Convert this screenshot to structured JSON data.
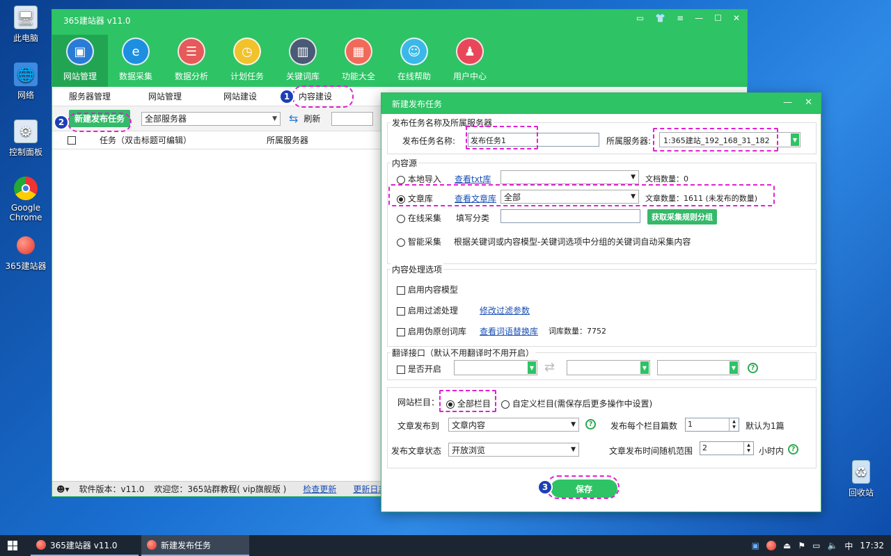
{
  "desktop": {
    "icons": [
      {
        "label": "此电脑",
        "icon": "computer-icon"
      },
      {
        "label": "网络",
        "icon": "network-icon"
      },
      {
        "label": "控制面板",
        "icon": "control-panel-icon"
      },
      {
        "label": "Google Chrome",
        "icon": "chrome-icon"
      },
      {
        "label": "365建站器",
        "icon": "apple-icon"
      },
      {
        "label": "回收站",
        "icon": "recycle-bin-icon"
      }
    ]
  },
  "app": {
    "title": "365建站器 v11.0",
    "toolbar": [
      {
        "label": "网站管理",
        "icon": "monitor-icon",
        "color": "#2a7bd6"
      },
      {
        "label": "数据采集",
        "icon": "edge-icon",
        "color": "#1d8fe0"
      },
      {
        "label": "数据分析",
        "icon": "database-icon",
        "color": "#e65a5a"
      },
      {
        "label": "计划任务",
        "icon": "clock-icon",
        "color": "#f2c22d"
      },
      {
        "label": "关键词库",
        "icon": "book-icon",
        "color": "#4a5a75"
      },
      {
        "label": "功能大全",
        "icon": "grid-icon",
        "color": "#f06a5a"
      },
      {
        "label": "在线帮助",
        "icon": "support-icon",
        "color": "#3bb8e8"
      },
      {
        "label": "用户中心",
        "icon": "user-icon",
        "color": "#e8475a"
      }
    ],
    "subtabs": [
      "服务器管理",
      "网站管理",
      "网站建设",
      "内容建设"
    ],
    "opbar": {
      "new_task": "新建发布任务",
      "server_select": "全部服务器",
      "refresh": "刷新"
    },
    "grid_headers": {
      "task": "任务（双击标题可编辑）",
      "server": "所属服务器"
    },
    "statusbar": {
      "version": "软件版本：v11.0",
      "welcome": "欢迎您：365站群教程( vip旗舰版 )",
      "check_update": "检查更新",
      "changelog": "更新日志"
    },
    "badges": [
      "1",
      "2",
      "3"
    ]
  },
  "dialog": {
    "title": "新建发布任务",
    "section_name": {
      "legend": "发布任务名称及所属服务器",
      "task_name_label": "发布任务名称:",
      "task_name_value": "发布任务1",
      "server_label": "所属服务器:",
      "server_value": "1:365建站_192_168_31_182"
    },
    "section_source": {
      "legend": "内容源",
      "local": {
        "label": "本地导入",
        "link": "查看txt库",
        "count_label": "文档数量：0"
      },
      "library": {
        "label": "文章库",
        "link": "查看文章库",
        "select": "全部",
        "count_label": "文章数量：1611 (未发布的数量)"
      },
      "online": {
        "label": "在线采集",
        "fill_label": "填写分类",
        "button": "获取采集规则分组"
      },
      "smart": {
        "label": "智能采集",
        "desc": "根据关键词或内容模型-关键词选项中分组的关键词自动采集内容"
      }
    },
    "section_process": {
      "legend": "内容处理选项",
      "model": "启用内容模型",
      "filter": "启用过滤处理",
      "filter_link": "修改过滤参数",
      "pseudo": "启用伪原创词库",
      "pseudo_link": "查看词语替换库",
      "lexicon_count": "词库数量：7752"
    },
    "section_translate": {
      "legend": "翻译接口（默认不用翻译时不用开启）",
      "enable": "是否开启"
    },
    "section_publish": {
      "column_label": "网站栏目：",
      "all_columns": "全部栏目",
      "custom_columns": "自定义栏目(需保存后更多操作中设置)",
      "publish_to_label": "文章发布到",
      "publish_to_value": "文章内容",
      "per_column_label": "发布每个栏目篇数",
      "per_column_value": "1",
      "per_column_default": "默认为1篇",
      "status_label": "发布文章状态",
      "status_value": "开放浏览",
      "random_label": "文章发布时间随机范围",
      "random_value": "2",
      "random_unit": "小时内"
    },
    "save": "保存"
  },
  "taskbar": {
    "items": [
      "365建站器 v11.0",
      "新建发布任务"
    ],
    "ime": "中",
    "time": "17:32"
  }
}
